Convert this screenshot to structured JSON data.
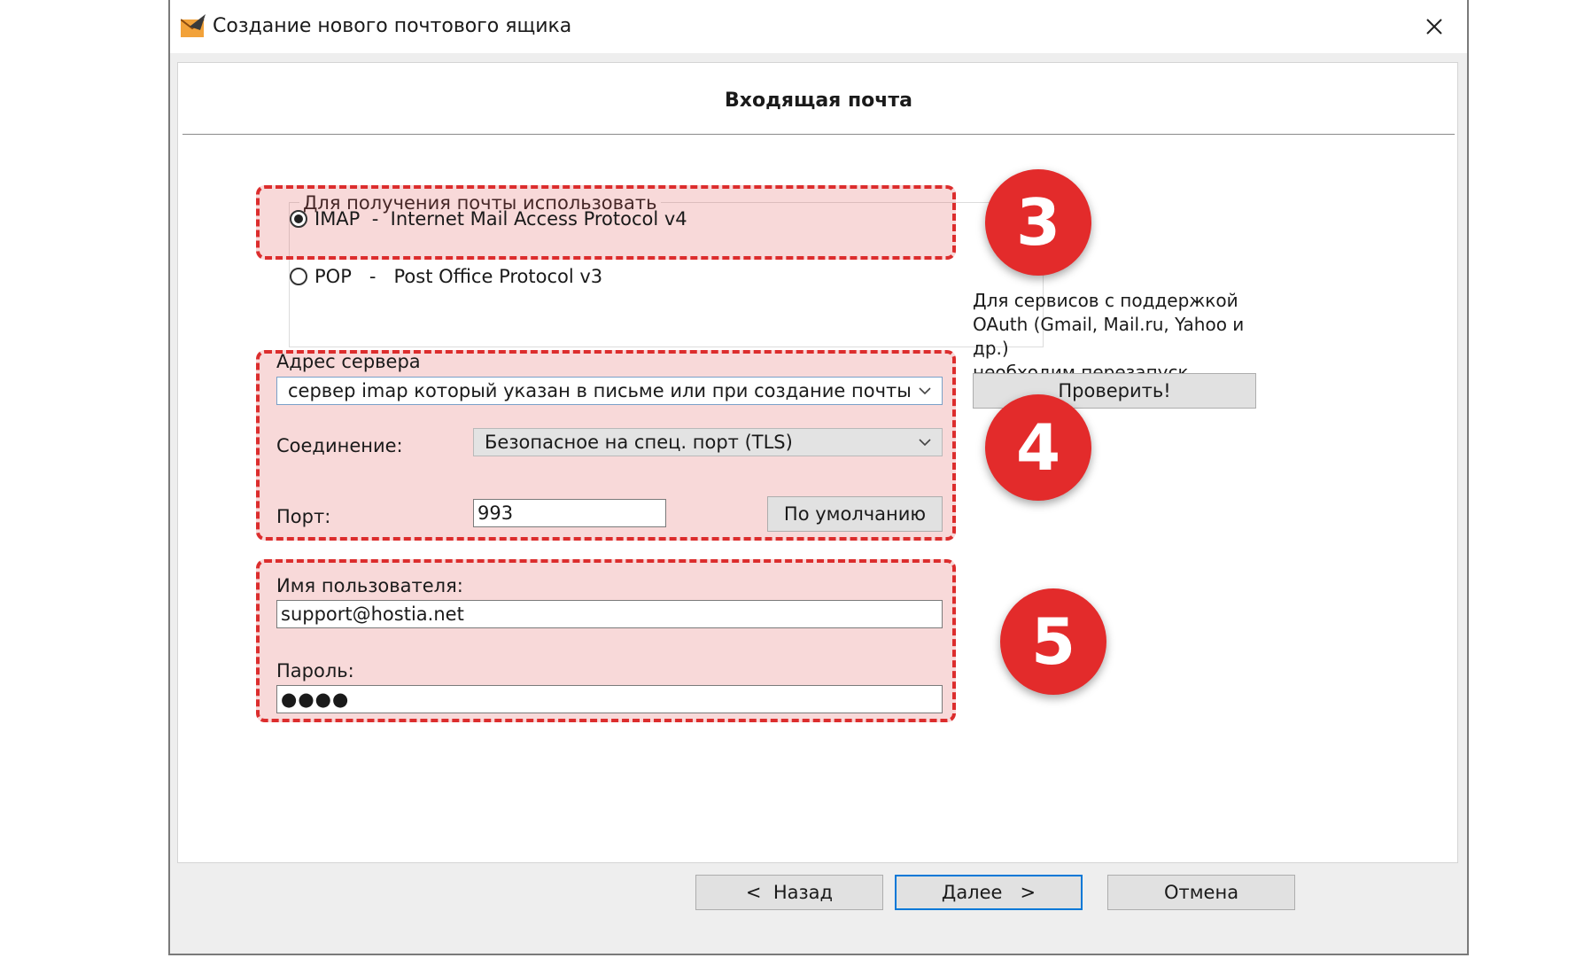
{
  "window": {
    "title": "Создание нового почтового ящика",
    "close_glyph": "✕"
  },
  "page": {
    "heading": "Входящая почта"
  },
  "protocol": {
    "legend": "Для получения почты использовать",
    "options": [
      {
        "label": "IMAP  -  Internet Mail Access Protocol v4",
        "selected": true
      },
      {
        "label": "POP   -   Post Office Protocol v3",
        "selected": false
      }
    ]
  },
  "server": {
    "address_label": "Адрес сервера",
    "address_value": "сервер imap который указан в письме или при создание почты",
    "connection_label": "Соединение:",
    "connection_value": "Безопасное на спец. порт (TLS)",
    "port_label": "Порт:",
    "port_value": "993",
    "default_button": "По умолчанию"
  },
  "credentials": {
    "username_label": "Имя пользователя:",
    "username_value": "support@hostia.net",
    "password_label": "Пароль:",
    "password_value": "●●●●"
  },
  "oauth": {
    "note_line1": "Для сервисов с поддержкой",
    "note_line2": "OAuth (Gmail, Mail.ru, Yahoo и др.)",
    "note_line3": "необходим перезапуск",
    "check_button": "Проверить!"
  },
  "badges": [
    "3",
    "4",
    "5"
  ],
  "footer": {
    "back_button": "<  Назад",
    "next_button": "Далее   >",
    "cancel_button": "Отмена"
  },
  "colors": {
    "highlight_border": "#dc2d2d",
    "badge": "#e32b2b",
    "primary_button_border": "#0078d7"
  },
  "icons": [
    "app-icon",
    "close-icon",
    "chevron-down-icon"
  ]
}
